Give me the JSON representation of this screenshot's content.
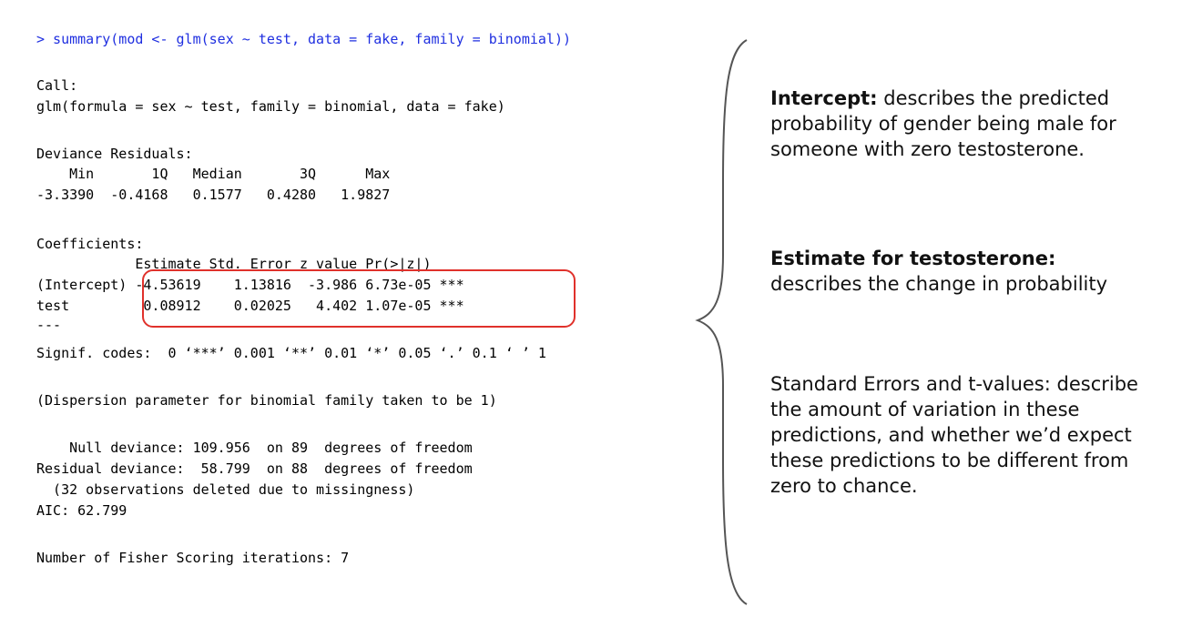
{
  "console": {
    "command": "> summary(mod <- glm(sex ~ test, data = fake, family = binomial))",
    "call_header": "Call:",
    "call_formula": "glm(formula = sex ~ test, family = binomial, data = fake)",
    "deviance_header": "Deviance Residuals:",
    "deviance_labels": "    Min       1Q   Median       3Q      Max  ",
    "deviance_values": "-3.3390  -0.4168   0.1577   0.4280   1.9827  ",
    "coef_header": "Coefficients:",
    "coef_columns": "            Estimate Std. Error z value Pr(>|z|)    ",
    "coef_intercept": "(Intercept) -4.53619    1.13816  -3.986 6.73e-05 ***",
    "coef_test": "test         0.08912    0.02025   4.402 1.07e-05 ***",
    "separator": "---",
    "signif_codes": "Signif. codes:  0 ‘***’ 0.001 ‘**’ 0.01 ‘*’ 0.05 ‘.’ 0.1 ‘ ’ 1",
    "dispersion": "(Dispersion parameter for binomial family taken to be 1)",
    "null_deviance": "    Null deviance: 109.956  on 89  degrees of freedom",
    "residual_deviance": "Residual deviance:  58.799  on 88  degrees of freedom",
    "missingness": "  (32 observations deleted due to missingness)",
    "aic": "AIC: 62.799",
    "fisher": "Number of Fisher Scoring iterations: 7"
  },
  "notes": {
    "intercept_title": "Intercept:",
    "intercept_text": " describes the predicted probability of gender being male for someone with zero testosterone.",
    "estimate_title": "Estimate for testosterone:",
    "estimate_text": "describes the change in probability",
    "stderr_text": "Standard Errors and t-values: describe the amount of variation in these predictions, and whether we’d expect these predictions to be different from zero to chance."
  },
  "colors": {
    "command": "#1f2fe0",
    "highlight_box": "#e0312b",
    "brace": "#555555",
    "text": "#111111"
  }
}
